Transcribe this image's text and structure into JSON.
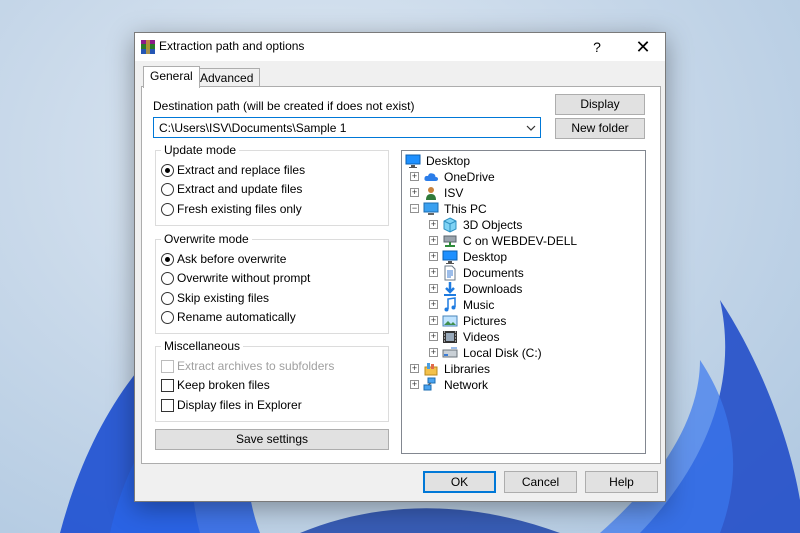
{
  "colors": {
    "accent": "#0078d7",
    "dialog_bg": "#f0f0f0",
    "wallpaper_blue": "#1a4fd6"
  },
  "dialog": {
    "title": "Extraction path and options",
    "help_label": "?",
    "close_label": "✕",
    "tabs": [
      {
        "label": "General",
        "active": true
      },
      {
        "label": "Advanced",
        "active": false
      }
    ]
  },
  "destination": {
    "label": "Destination path (will be created if does not exist)",
    "value": "C:\\Users\\ISV\\Documents\\Sample 1",
    "display_button": "Display",
    "new_folder_button": "New folder"
  },
  "update_mode": {
    "title": "Update mode",
    "options": [
      {
        "label": "Extract and replace files",
        "selected": true
      },
      {
        "label": "Extract and update files",
        "selected": false
      },
      {
        "label": "Fresh existing files only",
        "selected": false
      }
    ]
  },
  "overwrite_mode": {
    "title": "Overwrite mode",
    "options": [
      {
        "label": "Ask before overwrite",
        "selected": true
      },
      {
        "label": "Overwrite without prompt",
        "selected": false
      },
      {
        "label": "Skip existing files",
        "selected": false
      },
      {
        "label": "Rename automatically",
        "selected": false
      }
    ]
  },
  "miscellaneous": {
    "title": "Miscellaneous",
    "options": [
      {
        "label": "Extract archives to subfolders",
        "checked": false,
        "disabled": true
      },
      {
        "label": "Keep broken files",
        "checked": false,
        "disabled": false
      },
      {
        "label": "Display files in Explorer",
        "checked": false,
        "disabled": false
      }
    ]
  },
  "save_settings_button": "Save settings",
  "tree": {
    "nodes": [
      {
        "label": "Desktop",
        "icon": "desktop-icon",
        "level": 0,
        "expander": ""
      },
      {
        "label": "OneDrive",
        "icon": "cloud-icon",
        "level": 1,
        "expander": "+"
      },
      {
        "label": "ISV",
        "icon": "user-icon",
        "level": 1,
        "expander": "+"
      },
      {
        "label": "This PC",
        "icon": "computer-icon",
        "level": 1,
        "expander": "−"
      },
      {
        "label": "3D Objects",
        "icon": "cube-icon",
        "level": 2,
        "expander": "+"
      },
      {
        "label": "C on WEBDEV-DELL",
        "icon": "network-drive-icon",
        "level": 2,
        "expander": "+"
      },
      {
        "label": "Desktop",
        "icon": "desktop-icon",
        "level": 2,
        "expander": "+"
      },
      {
        "label": "Documents",
        "icon": "document-icon",
        "level": 2,
        "expander": "+"
      },
      {
        "label": "Downloads",
        "icon": "download-icon",
        "level": 2,
        "expander": "+"
      },
      {
        "label": "Music",
        "icon": "music-icon",
        "level": 2,
        "expander": "+"
      },
      {
        "label": "Pictures",
        "icon": "picture-icon",
        "level": 2,
        "expander": "+"
      },
      {
        "label": "Videos",
        "icon": "video-icon",
        "level": 2,
        "expander": "+"
      },
      {
        "label": "Local Disk (C:)",
        "icon": "disk-icon",
        "level": 2,
        "expander": "+"
      },
      {
        "label": "Libraries",
        "icon": "library-icon",
        "level": 1,
        "expander": "+"
      },
      {
        "label": "Network",
        "icon": "network-icon",
        "level": 1,
        "expander": "+"
      }
    ]
  },
  "footer": {
    "ok": "OK",
    "cancel": "Cancel",
    "help": "Help"
  }
}
